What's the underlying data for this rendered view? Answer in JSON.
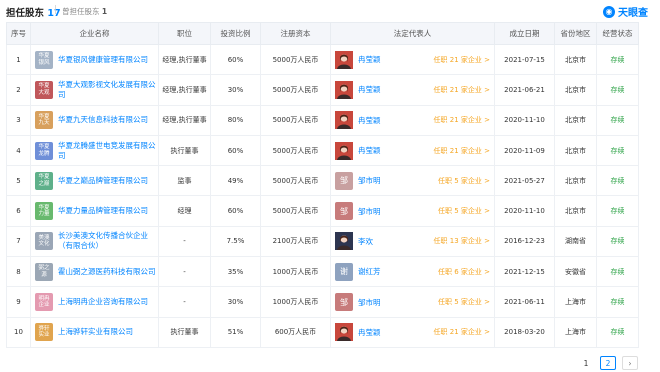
{
  "header": {
    "tab_active_label": "担任股东",
    "tab_active_count": "17",
    "tab_inactive_label": "曾担任股东",
    "tab_inactive_count": "1",
    "logo_text": "天眼查"
  },
  "table": {
    "columns": [
      "序号",
      "企业名称",
      "职位",
      "投资比例",
      "注册资本",
      "法定代表人",
      "成立日期",
      "省份地区",
      "经营状态"
    ],
    "rows": [
      {
        "no": "1",
        "logo_text": "华夏银风",
        "logo_color": "#a4b3c6",
        "name": "华夏银风健康管理有限公司",
        "position": "经理,执行董事",
        "ratio": "60%",
        "capital": "5000万人民币",
        "rep": "冉莹颖",
        "rep_link": "任职 21 家企业 >",
        "date": "2021-07-15",
        "region": "北京市",
        "status": "存续",
        "avatar_type": "photo",
        "avatar_color": "#c8473c"
      },
      {
        "no": "2",
        "logo_text": "华夏大观",
        "logo_color": "#c0575b",
        "name": "华夏大观影视文化发展有限公司",
        "position": "经理,执行董事",
        "ratio": "30%",
        "capital": "5000万人民币",
        "rep": "冉莹颖",
        "rep_link": "任职 21 家企业 >",
        "date": "2021-06-21",
        "region": "北京市",
        "status": "存续",
        "avatar_type": "photo",
        "avatar_color": "#c8473c"
      },
      {
        "no": "3",
        "logo_text": "华夏九天",
        "logo_color": "#d8a05d",
        "name": "华夏九天信息科技有限公司",
        "position": "经理,执行董事",
        "ratio": "80%",
        "capital": "5000万人民币",
        "rep": "冉莹颖",
        "rep_link": "任职 21 家企业 >",
        "date": "2020-11-10",
        "region": "北京市",
        "status": "存续",
        "avatar_type": "photo",
        "avatar_color": "#c8473c"
      },
      {
        "no": "4",
        "logo_text": "华夏龙腾",
        "logo_color": "#6f8fd8",
        "name": "华夏龙腾盛世电竞发展有限公司",
        "position": "执行董事",
        "ratio": "60%",
        "capital": "5000万人民币",
        "rep": "冉莹颖",
        "rep_link": "任职 21 家企业 >",
        "date": "2020-11-09",
        "region": "北京市",
        "status": "存续",
        "avatar_type": "photo",
        "avatar_color": "#c8473c"
      },
      {
        "no": "5",
        "logo_text": "华夏之巅",
        "logo_color": "#5eb08a",
        "name": "华夏之巅品牌管理有限公司",
        "position": "监事",
        "ratio": "49%",
        "capital": "5000万人民币",
        "rep": "邹市明",
        "rep_link": "任职 5 家企业 >",
        "date": "2021-05-27",
        "region": "北京市",
        "status": "存续",
        "avatar_type": "initial",
        "avatar_initial": "邹",
        "avatar_color": "#c8a0a0"
      },
      {
        "no": "6",
        "logo_text": "华夏力量",
        "logo_color": "#68b96e",
        "name": "华夏力量品牌管理有限公司",
        "position": "经理",
        "ratio": "60%",
        "capital": "5000万人民币",
        "rep": "邹市明",
        "rep_link": "任职 5 家企业 >",
        "date": "2020-11-10",
        "region": "北京市",
        "status": "存续",
        "avatar_type": "initial",
        "avatar_initial": "邹",
        "avatar_color": "#c77b7b"
      },
      {
        "no": "7",
        "logo_text": "美澳文化",
        "logo_color": "#9aa6b6",
        "name": "长沙美澳文化传播合伙企业（有限合伙）",
        "position": "-",
        "ratio": "7.5%",
        "capital": "2100万人民币",
        "rep": "李欢",
        "rep_link": "任职 13 家企业 >",
        "date": "2016-12-23",
        "region": "湖南省",
        "status": "存续",
        "avatar_type": "photo",
        "avatar_color": "#2d3550"
      },
      {
        "no": "8",
        "logo_text": "弼之源",
        "logo_color": "#9ba7b5",
        "name": "霍山弼之源医药科技有限公司",
        "position": "-",
        "ratio": "35%",
        "capital": "1000万人民币",
        "rep": "谢红芳",
        "rep_link": "任职 6 家企业 >",
        "date": "2021-12-15",
        "region": "安徽省",
        "status": "存续",
        "avatar_type": "initial",
        "avatar_initial": "谢",
        "avatar_color": "#8ea2bf"
      },
      {
        "no": "9",
        "logo_text": "明冉企业",
        "logo_color": "#e49ab0",
        "name": "上海明冉企业咨询有限公司",
        "position": "-",
        "ratio": "30%",
        "capital": "1000万人民币",
        "rep": "邹市明",
        "rep_link": "任职 5 家企业 >",
        "date": "2021-06-11",
        "region": "上海市",
        "status": "存续",
        "avatar_type": "initial",
        "avatar_initial": "邹",
        "avatar_color": "#c77b7b"
      },
      {
        "no": "10",
        "logo_text": "骅轩实业",
        "logo_color": "#e0a44e",
        "name": "上海骅轩实业有限公司",
        "position": "执行董事",
        "ratio": "51%",
        "capital": "600万人民币",
        "rep": "冉莹颖",
        "rep_link": "任职 21 家企业 >",
        "date": "2018-03-20",
        "region": "上海市",
        "status": "存续",
        "avatar_type": "photo",
        "avatar_color": "#c8473c"
      }
    ]
  },
  "pagination": {
    "page_1": "1",
    "page_2": "2",
    "next": "›"
  },
  "colors": {
    "accent": "#0084ff",
    "status_active": "#2ba245",
    "link_orange": "#f5a623"
  }
}
